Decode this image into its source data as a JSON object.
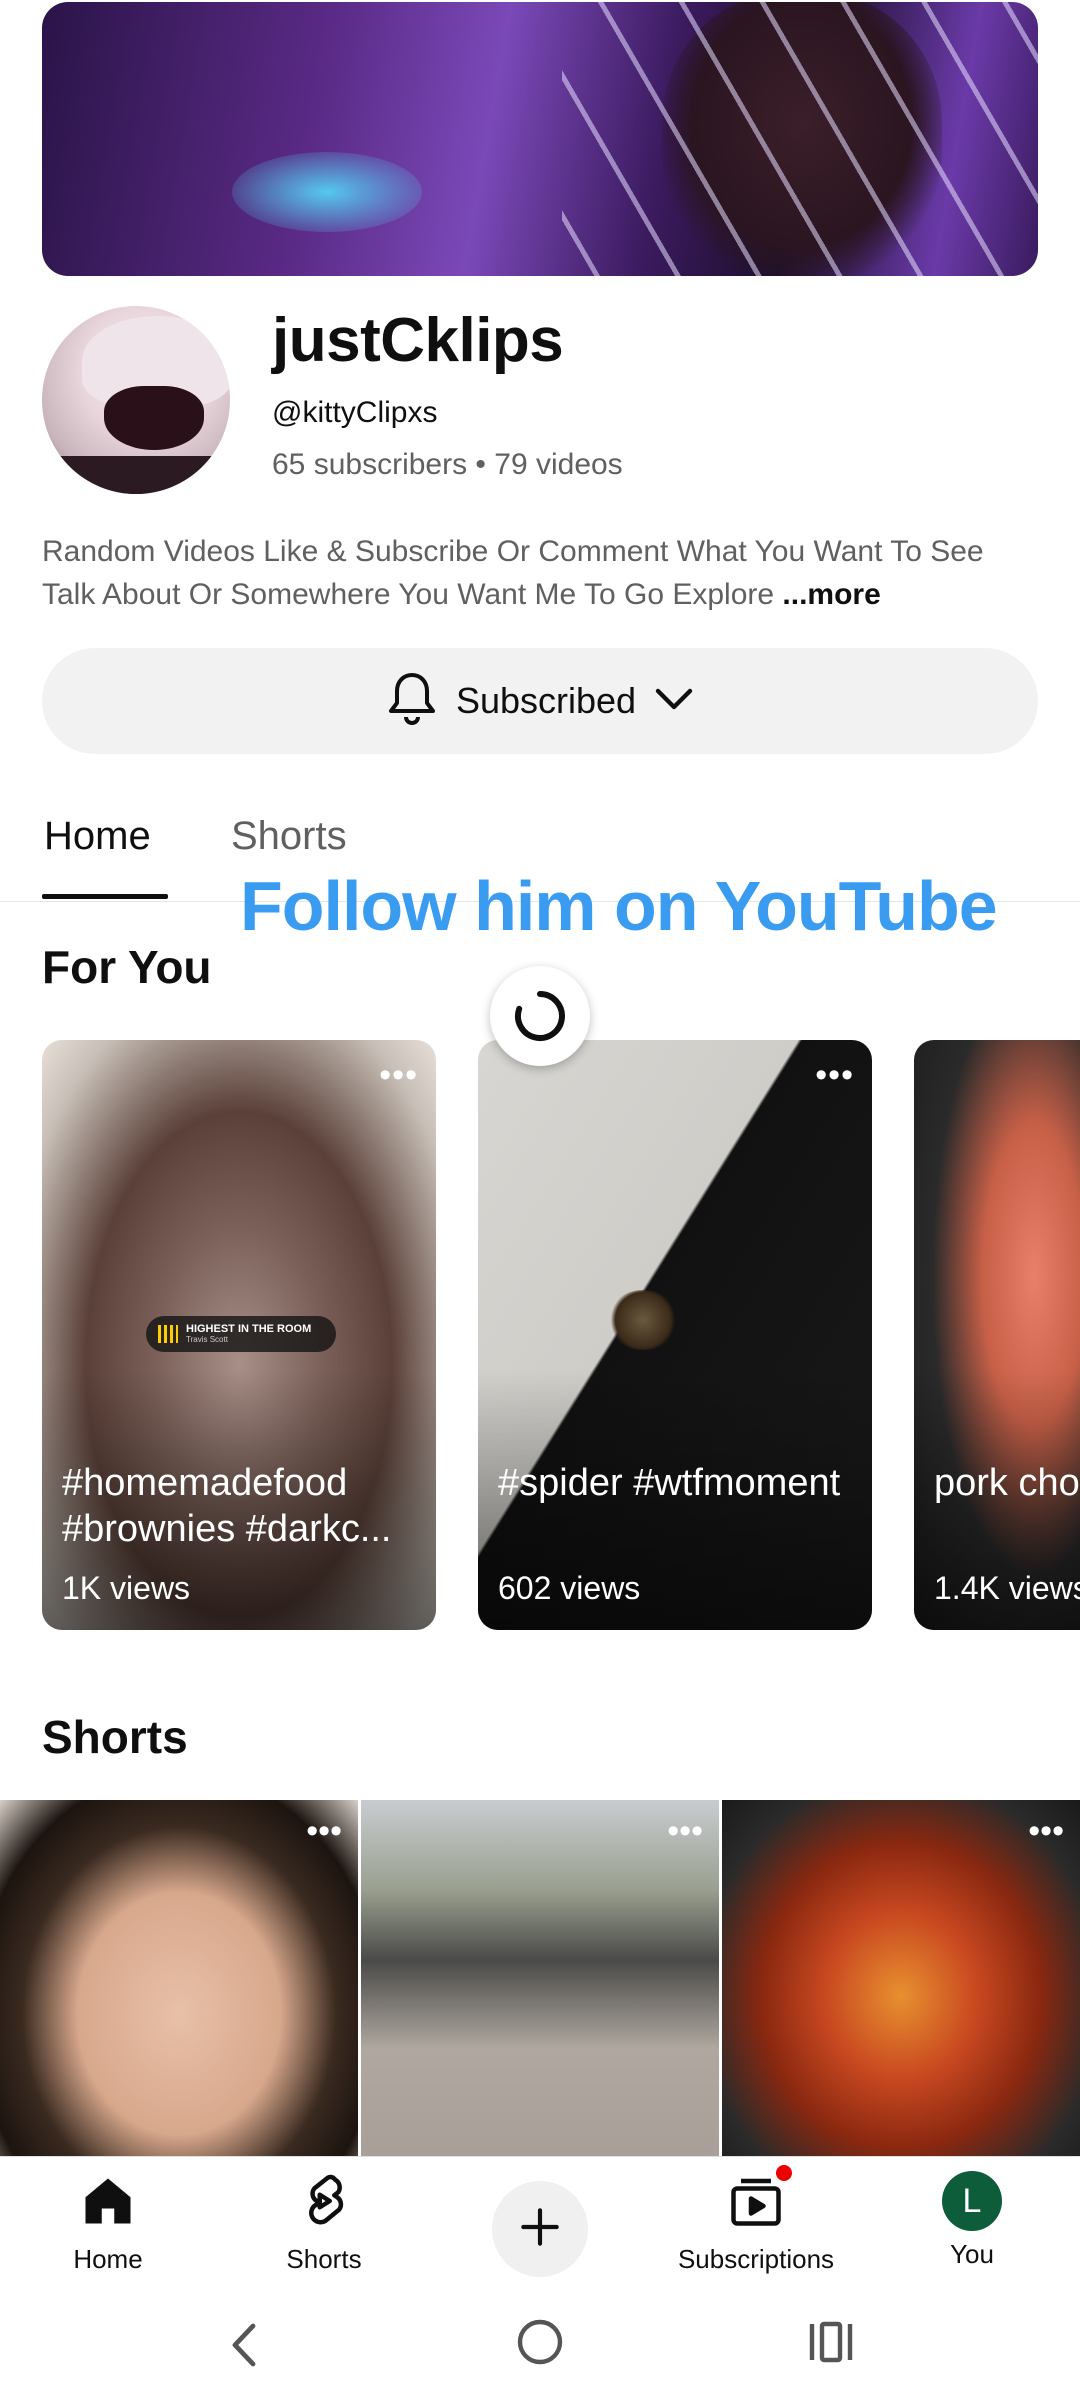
{
  "channel": {
    "name": "justCklips",
    "handle": "@kittyClipxs",
    "stats": "65 subscribers • 79 videos",
    "description": "Random Videos Like & Subscribe Or Comment What You Want To See Talk About Or Somewhere You Want Me To Go Explore",
    "more_label": "...more"
  },
  "subscribe": {
    "label": "Subscribed"
  },
  "tabs": [
    {
      "label": "Home"
    },
    {
      "label": "Shorts"
    }
  ],
  "overlay_caption": "Follow him on YouTube",
  "sections": {
    "for_you": "For You",
    "shorts": "Shorts"
  },
  "for_you_cards": [
    {
      "title": "#homemadefood #brownies #darkc...",
      "views": "1K views",
      "music_title": "HIGHEST IN THE ROOM",
      "music_artist": "Travis Scott"
    },
    {
      "title": "#spider #wtfmoment",
      "views": "602 views"
    },
    {
      "title": "pork cho #foodfo",
      "views": "1.4K views"
    }
  ],
  "shorts_tiles": [
    {
      "name": "short-face"
    },
    {
      "name": "short-memorial"
    },
    {
      "name": "short-cooking"
    }
  ],
  "bottom_nav": {
    "home": "Home",
    "shorts": "Shorts",
    "subscriptions": "Subscriptions",
    "you": "You",
    "you_initial": "L"
  },
  "colors": {
    "accent_blue": "#3a9cf0",
    "you_avatar_bg": "#0d5c3a",
    "notification_red": "#ee0000"
  }
}
